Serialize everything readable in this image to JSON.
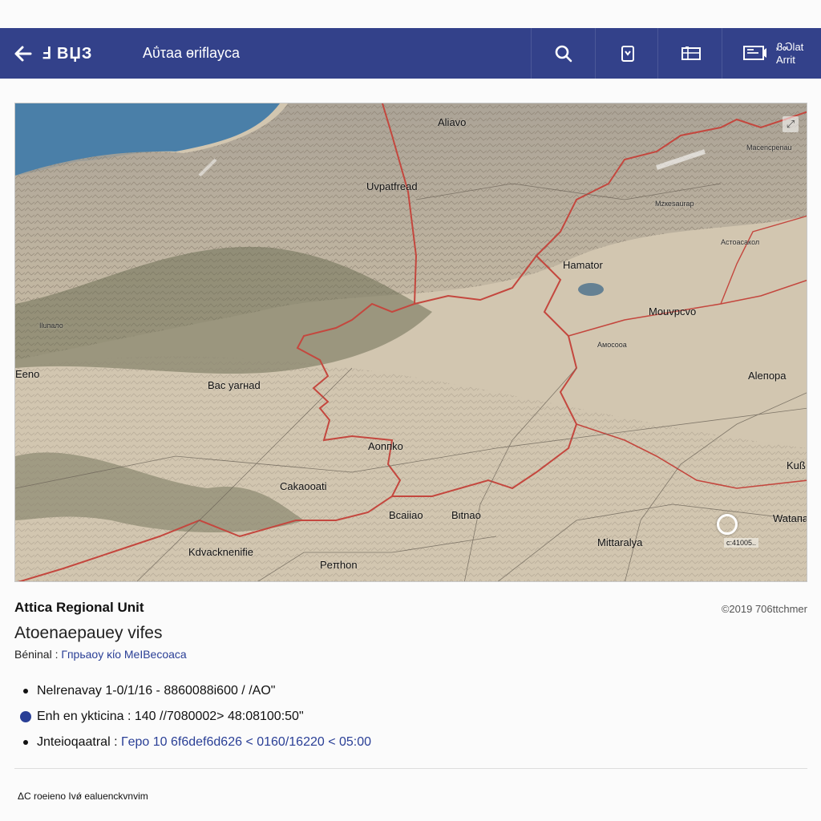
{
  "header": {
    "back_icon": "arrow-left-icon",
    "logo": "Ⅎ BЏЗ",
    "title": "Aΰτaa ɵriflayca",
    "search_icon": "search-icon",
    "bookmark_icon": "bookmark-icon",
    "layers_icon": "map-icon",
    "screen_icon": "screen-icon",
    "stack_line1": "ᏰᏍlat",
    "stack_line2": "Arrit",
    "bar_color": "#33418a"
  },
  "map": {
    "labels": [
      {
        "text": "Aliavo",
        "size": "normal"
      },
      {
        "text": "Uvpatfread",
        "size": "normal"
      },
      {
        "text": "Hamator",
        "size": "normal"
      },
      {
        "text": "Mouvpcvo",
        "size": "normal"
      },
      {
        "text": "Aleпopa",
        "size": "normal"
      },
      {
        "text": "Bac yarнad",
        "size": "normal"
      },
      {
        "text": "Aonпko",
        "size": "normal"
      },
      {
        "text": "Cakaooati",
        "size": "normal"
      },
      {
        "text": "Bcaiiao",
        "size": "normal"
      },
      {
        "text": "Bιtnao",
        "size": "normal"
      },
      {
        "text": "Mittaralya",
        "size": "normal"
      },
      {
        "text": "Kdvacknenifie",
        "size": "normal"
      },
      {
        "text": "Peπhon",
        "size": "normal"
      },
      {
        "text": "Wataпa",
        "size": "normal"
      },
      {
        "text": "Kuß",
        "size": "normal"
      },
      {
        "text": "Eeno",
        "size": "normal"
      },
      {
        "text": "Мaсenсpenau",
        "size": "small"
      },
      {
        "text": "Mzкesaurap",
        "size": "small"
      },
      {
        "text": "Аcтоaсакол",
        "size": "small"
      },
      {
        "text": "Aмоcooa",
        "size": "small"
      },
      {
        "text": "Iluпaло",
        "size": "small"
      }
    ],
    "scale_text": "c:41005..",
    "region_border_color": "#c4473e",
    "water_color": "#4a7fa8"
  },
  "info": {
    "region": "Attica Regional Unit",
    "copyright": "©2019 706ttchmer",
    "subtitle": "Atoenaepauey vifes",
    "breadcrumb_label": "Béninal :",
    "breadcrumb_link": "Гпрьaoy κίο MeIBecoaca"
  },
  "coords": [
    {
      "icon": "bullet-icon",
      "label": "Nelrenavay",
      "value": "1-0/1/16 - 8860088i600 / /AO\""
    },
    {
      "icon": "location-pin-icon",
      "label": "Enh en ykticina :",
      "value": "140 //7080002> 48:08100:50\""
    },
    {
      "icon": "bullet-icon",
      "label": "Jnteioqaatral :",
      "value": "Гepo 10 6f6def6d626 < 0160/16220 < 05:00"
    }
  ],
  "footer": {
    "text": "ΔC roeieno Ivǿ ealuenckvnvim"
  }
}
